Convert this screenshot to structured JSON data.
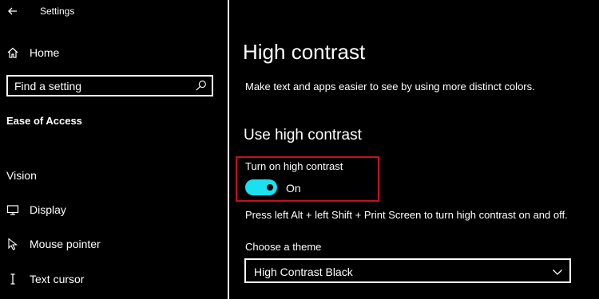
{
  "window": {
    "title": "Settings"
  },
  "sidebar": {
    "home_label": "Home",
    "search_placeholder": "Find a setting",
    "section_title": "Ease of Access",
    "group_title": "Vision",
    "items": [
      {
        "label": "Display",
        "icon": "display-icon"
      },
      {
        "label": "Mouse pointer",
        "icon": "mouse-pointer-icon"
      },
      {
        "label": "Text cursor",
        "icon": "text-cursor-icon"
      }
    ]
  },
  "main": {
    "page_title": "High contrast",
    "description": "Make text and apps easier to see by using more distinct colors.",
    "subheading": "Use high contrast",
    "toggle": {
      "label": "Turn on high contrast",
      "state": "On",
      "is_on": true
    },
    "shortcut_text": "Press left Alt + left Shift + Print Screen to turn high contrast on and off.",
    "theme": {
      "label": "Choose a theme",
      "selected": "High Contrast Black"
    }
  },
  "colors": {
    "background": "#000000",
    "text": "#ffffff",
    "toggle_on": "#1ae0f0",
    "highlight_box": "#c4101f"
  }
}
